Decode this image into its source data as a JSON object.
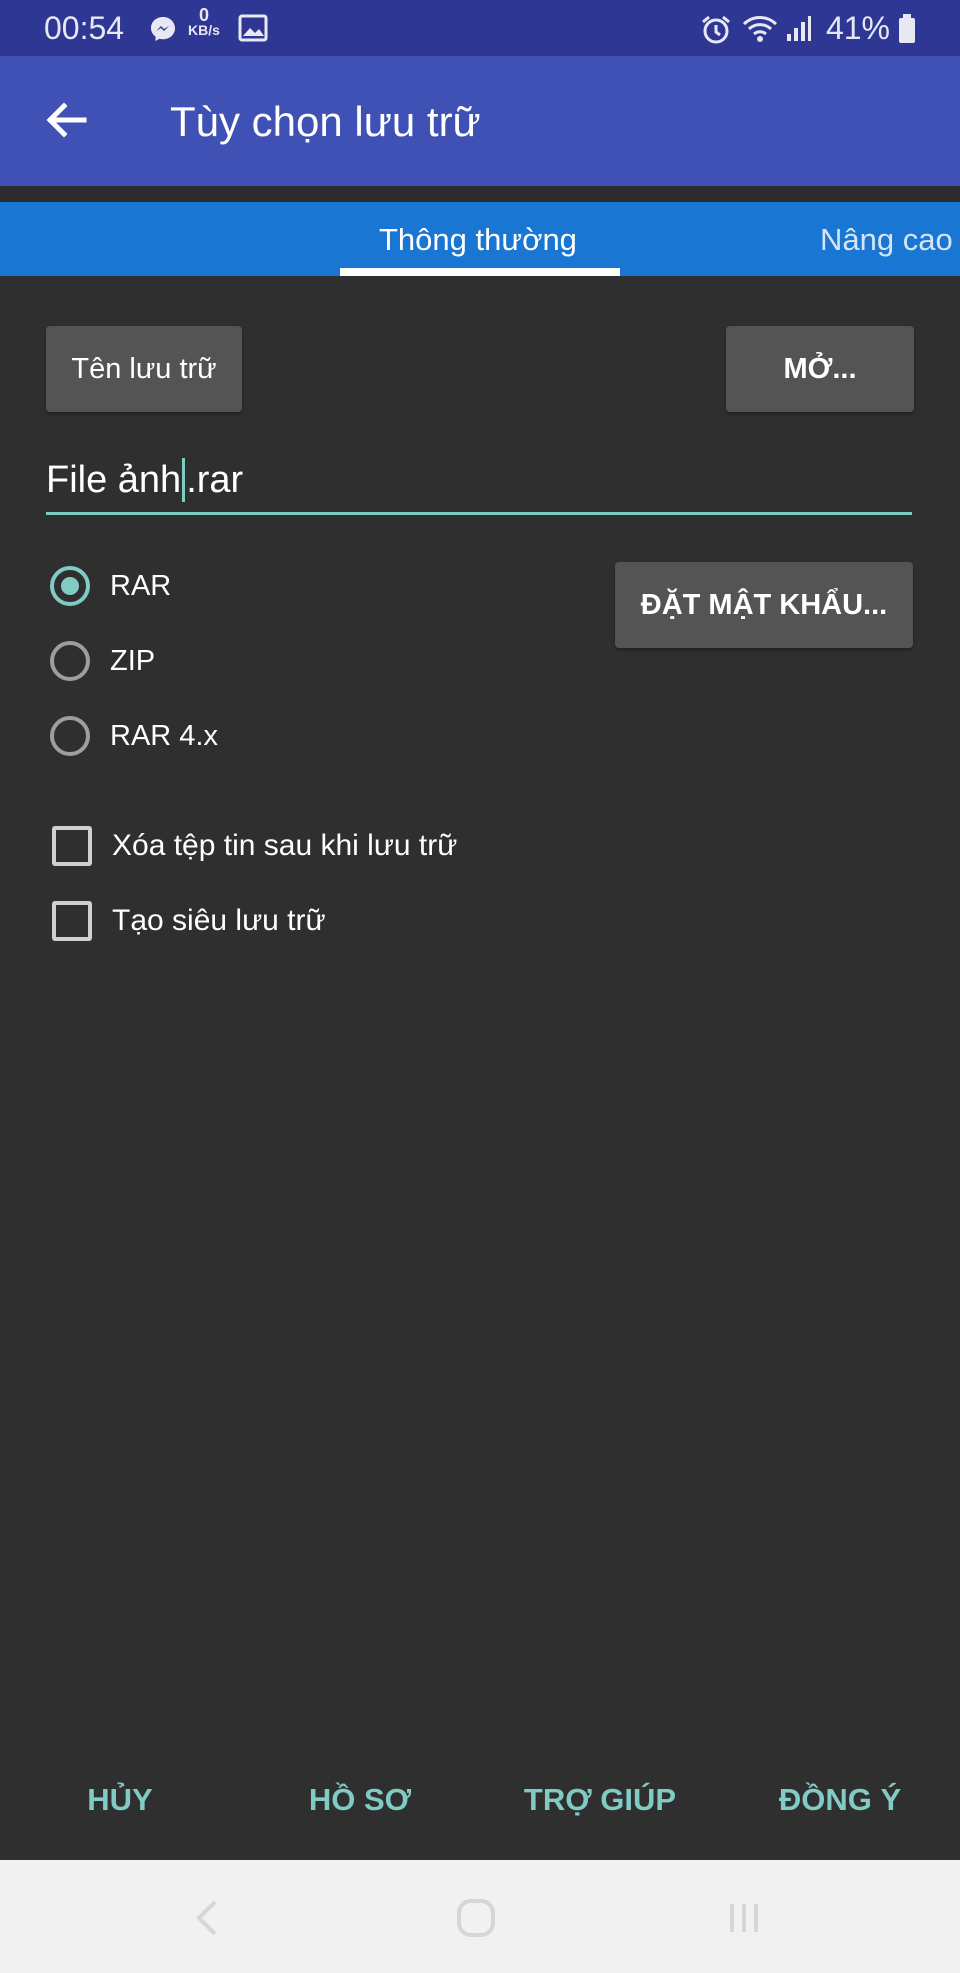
{
  "status_bar": {
    "time": "00:54",
    "net_speed_value": "0",
    "net_speed_unit": "KB/s",
    "battery": "41%",
    "icons": [
      "messenger-icon",
      "gallery-icon",
      "alarm-icon",
      "wifi-icon",
      "signal-icon",
      "battery-icon"
    ]
  },
  "app_bar": {
    "title": "Tùy chọn lưu trữ",
    "back_icon": "arrow-left-icon"
  },
  "tabs": [
    {
      "label": "Thông thường",
      "active": true
    },
    {
      "label": "Nâng cao",
      "active": false
    }
  ],
  "buttons": {
    "archive_name": "Tên lưu trữ",
    "browse": "MỞ...",
    "set_password": "ĐẶT MẬT KHẨU..."
  },
  "filename": {
    "value_before_caret": "File ảnh",
    "value_after_caret": ".rar"
  },
  "formats": [
    {
      "label": "RAR",
      "checked": true
    },
    {
      "label": "ZIP",
      "checked": false
    },
    {
      "label": "RAR 4.x",
      "checked": false
    }
  ],
  "options": [
    {
      "label": "Xóa tệp tin sau khi lưu trữ",
      "checked": false
    },
    {
      "label": "Tạo siêu lưu trữ",
      "checked": false
    }
  ],
  "actions": {
    "cancel": "HỦY",
    "profiles": "HỒ SƠ",
    "help": "TRỢ GIÚP",
    "ok": "ĐỒNG Ý"
  },
  "colors": {
    "status_bar": "#2f3794",
    "app_bar": "#3f51b5",
    "tab_bar": "#1976d2",
    "background": "#2f2f2f",
    "accent": "#80cbc4",
    "button": "#545454"
  }
}
